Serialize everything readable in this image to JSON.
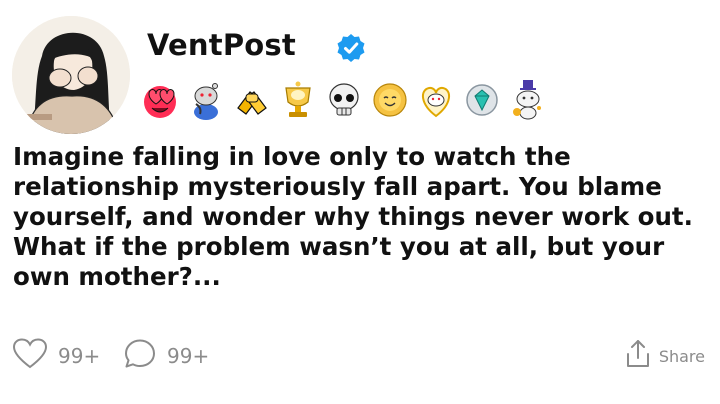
{
  "post": {
    "author": "VentPost",
    "verified": true,
    "body": "Imagine falling in love only to watch the relationship mysteriously fall apart. You blame yourself, and wonder why things never work out. What if the problem wasn’t you at all, but your own mother?...",
    "awards": [
      "heart-eyes-award-icon",
      "thinking-snoo-award-icon",
      "helping-hands-award-icon",
      "gold-trophy-award-icon",
      "skull-award-icon",
      "sun-face-award-icon",
      "wholesome-heart-award-icon",
      "gem-award-icon",
      "top-hat-snoo-award-icon"
    ]
  },
  "actions": {
    "likes": "99+",
    "comments": "99+",
    "share_label": "Share"
  },
  "colors": {
    "text": "#111111",
    "muted": "#8b8b8b",
    "verified": "#1d9bf0",
    "background": "#ffffff"
  }
}
